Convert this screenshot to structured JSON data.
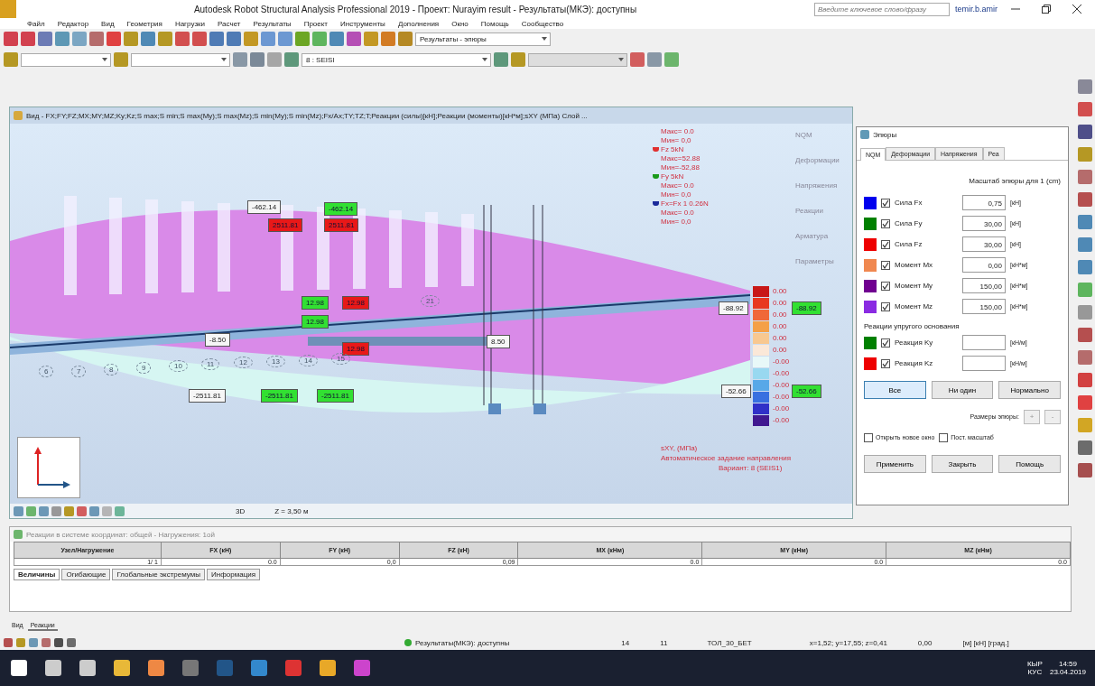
{
  "window": {
    "title": "Autodesk Robot Structural Analysis Professional 2019 - Проект: Nurayim result - Результаты(МКЭ): доступны",
    "search": {
      "placeholder": "Введите ключевое слово/фразу"
    },
    "user": "temir.b.amir"
  },
  "menu": [
    "Файл",
    "Редактор",
    "Вид",
    "Геометрия",
    "Нагрузки",
    "Расчет",
    "Результаты",
    "Проект",
    "Инструменты",
    "Дополнения",
    "Окно",
    "Помощь",
    "Сообщество"
  ],
  "toolbar": {
    "layout_select": "Результаты - эпюры",
    "case_select": "8 : SEISI"
  },
  "view": {
    "title": "Вид - FX;FY;FZ;MX;MY;MZ;Ky;Kz;S max;S min;S max(My);S max(Mz);S min(My);S min(Mz);Fx/Ax;TY;TZ;T;Реакции (силы)[кН];Реакции (моменты)[кН*м];sXY (МПа) Слой ...",
    "legend_lines": [
      {
        "text": "Макс=  0.0",
        "kind": "value"
      },
      {
        "text": "Мин=  0,0",
        "kind": "value"
      },
      {
        "text": "Fz  5kN",
        "kind": "head",
        "color": "#e03030"
      },
      {
        "text": "Макс=52.88",
        "kind": "value"
      },
      {
        "text": "Мин=-52,88",
        "kind": "value"
      },
      {
        "text": "Fy  5kN",
        "kind": "head",
        "color": "#1a9a1a"
      },
      {
        "text": "Макс=  0.0",
        "kind": "value"
      },
      {
        "text": "Мин=  0,0",
        "kind": "value"
      },
      {
        "text": "Fx=Fx 1 0.26N",
        "kind": "head",
        "color": "#1a2a9a"
      },
      {
        "text": "Макс=  0.0",
        "kind": "value"
      },
      {
        "text": "Мин=  0,0",
        "kind": "value"
      }
    ],
    "tags": [
      {
        "text": "-462.14",
        "kind": "plain"
      },
      {
        "text": "-462.14",
        "kind": "green"
      },
      {
        "text": "2511.81",
        "kind": "red"
      },
      {
        "text": "2511.81",
        "kind": "red"
      },
      {
        "text": "12.98",
        "kind": "green"
      },
      {
        "text": "12.98",
        "kind": "green"
      },
      {
        "text": "12.98",
        "kind": "red"
      },
      {
        "text": "12.98",
        "kind": "red"
      },
      {
        "text": "-8.50",
        "kind": "plain"
      },
      {
        "text": "8.50",
        "kind": "plain"
      },
      {
        "text": "-88.92",
        "kind": "plain"
      },
      {
        "text": "-88.92",
        "kind": "green"
      },
      {
        "text": "-52.66",
        "kind": "plain"
      },
      {
        "text": "-52.66",
        "kind": "green"
      },
      {
        "text": "-2511.81",
        "kind": "plain"
      },
      {
        "text": "-2511.81",
        "kind": "green"
      },
      {
        "text": "-2511.81",
        "kind": "green"
      }
    ],
    "node_numbers": [
      "6",
      "7",
      "8",
      "9",
      "10",
      "11",
      "12",
      "13",
      "14",
      "15",
      "21"
    ],
    "scale": [
      {
        "label": "0.00",
        "color": "#c81818"
      },
      {
        "label": "0.00",
        "color": "#e83820"
      },
      {
        "label": "0.00",
        "color": "#f06838"
      },
      {
        "label": "0.00",
        "color": "#f4a048"
      },
      {
        "label": "0.00",
        "color": "#f8c890"
      },
      {
        "label": "0.00",
        "color": "#fbe8d8"
      },
      {
        "label": "-0.00",
        "color": "#e8f8f8"
      },
      {
        "label": "-0.00",
        "color": "#98d8f0"
      },
      {
        "label": "-0.00",
        "color": "#58a8e8"
      },
      {
        "label": "-0.00",
        "color": "#3870e0"
      },
      {
        "label": "-0.00",
        "color": "#3030c8"
      },
      {
        "label": "-0.00",
        "color": "#401890"
      }
    ],
    "footer_lines": [
      "sXY, (МПа)",
      "Автоматическое задание направления",
      "Вариант: 8 (SEIS1)"
    ],
    "side_items": [
      "NQM",
      "Деформации",
      "Напряжения",
      "Реакции",
      "Арматура",
      "Параметры"
    ],
    "mode": "3D",
    "level": "Z = 3,50 м"
  },
  "dialog": {
    "title": "Эпюры",
    "tabs": [
      {
        "label": "NQM",
        "selected": true
      },
      {
        "label": "Деформации",
        "selected": false
      },
      {
        "label": "Напряжения",
        "selected": false
      },
      {
        "label": "Реа",
        "selected": false
      }
    ],
    "scale_caption": "Масштаб эпюры для 1  (cm)",
    "rows": [
      {
        "color": "#0000ee",
        "checked": true,
        "label": "Сила Fx",
        "value": "0,75",
        "unit": "[кН]"
      },
      {
        "color": "#008000",
        "checked": true,
        "label": "Сила Fy",
        "value": "30,00",
        "unit": "[кН]"
      },
      {
        "color": "#ee0000",
        "checked": true,
        "label": "Сила Fz",
        "value": "30,00",
        "unit": "[кН]"
      },
      {
        "color": "#f08850",
        "checked": true,
        "label": "Момент Mx",
        "value": "0,00",
        "unit": "[кН*м]"
      },
      {
        "color": "#700090",
        "checked": true,
        "label": "Момент My",
        "value": "150,00",
        "unit": "[кН*м]"
      },
      {
        "color": "#8a2be2",
        "checked": true,
        "label": "Момент Mz",
        "value": "150,00",
        "unit": "[кН*м]"
      }
    ],
    "section": "Реакции упругого основания",
    "reaction_rows": [
      {
        "color": "#008000",
        "checked": true,
        "label": "Реакция Ky",
        "unit": "[кН/м]"
      },
      {
        "color": "#ee0000",
        "checked": true,
        "label": "Реакция Kz",
        "unit": "[кН/м]"
      }
    ],
    "select_buttons": [
      {
        "label": "Все",
        "selected": true
      },
      {
        "label": "Ни один",
        "selected": false
      },
      {
        "label": "Нормально",
        "selected": false
      }
    ],
    "size_label": "Размеры эпюры:",
    "size_buttons": [
      "+",
      "-"
    ],
    "options": [
      {
        "label": "Открыть новое окно",
        "checked": false
      },
      {
        "label": "Пост. масштаб",
        "checked": false
      }
    ],
    "footer_buttons": [
      "Применить",
      "Закрыть",
      "Помощь"
    ]
  },
  "table_panel": {
    "title": "Реакции в системе координат: общей - Нагружения: 1ой",
    "columns": [
      "Узел/Нагружение",
      "FX (кН)",
      "FY (кН)",
      "FZ (кН)",
      "MX (кНм)",
      "MY (кНм)",
      "MZ (кНм)"
    ],
    "rows": [
      [
        "1/ 1",
        "0.0",
        "0,0",
        "0,09",
        "0.0",
        "0.0",
        "0.0"
      ]
    ],
    "tabs": [
      {
        "label": "Величины",
        "selected": true
      },
      {
        "label": "Огибающие",
        "selected": false
      },
      {
        "label": "Глобальные экстремумы",
        "selected": false
      },
      {
        "label": "Информация",
        "selected": false
      }
    ]
  },
  "lower_tabs": [
    {
      "label": "Вид",
      "selected": false
    },
    {
      "label": "Реакции",
      "selected": true
    }
  ],
  "status_bar": {
    "state": "Результаты(МКЭ): доступны",
    "items": [
      "14",
      "11",
      "ТОЛ_30_БЕТ",
      "x=1,52; y=17,55; z=0,41",
      "0,00",
      "[м] [кН] [град.]"
    ]
  },
  "taskbar": {
    "language": "КЫР",
    "layout": "КУС",
    "time": "14:59",
    "date": "23.04.2019"
  }
}
